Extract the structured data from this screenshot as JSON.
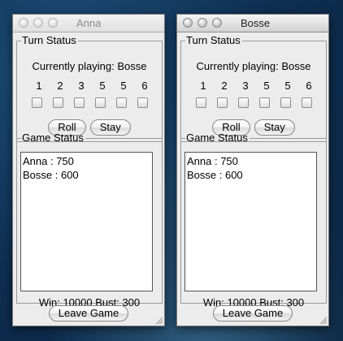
{
  "windows": [
    {
      "title": "Anna",
      "active": false,
      "turn_status": {
        "legend": "Turn Status",
        "currently_playing": "Currently playing: Bosse",
        "dice_labels": [
          "1",
          "2",
          "3",
          "5",
          "5",
          "6"
        ],
        "dice_checked": [
          false,
          false,
          false,
          false,
          false,
          false
        ],
        "roll_label": "Roll",
        "stay_label": "Stay"
      },
      "game_status": {
        "legend": "Game Status",
        "scores": [
          "Anna : 750",
          "Bosse : 600"
        ],
        "win_bust": "Win: 10000 Bust: 300"
      },
      "leave_label": "Leave Game"
    },
    {
      "title": "Bosse",
      "active": true,
      "turn_status": {
        "legend": "Turn Status",
        "currently_playing": "Currently playing: Bosse",
        "dice_labels": [
          "1",
          "2",
          "3",
          "5",
          "5",
          "6"
        ],
        "dice_checked": [
          false,
          false,
          false,
          false,
          false,
          false
        ],
        "roll_label": "Roll",
        "stay_label": "Stay"
      },
      "game_status": {
        "legend": "Game Status",
        "scores": [
          "Anna : 750",
          "Bosse : 600"
        ],
        "win_bust": "Win: 10000 Bust: 300"
      },
      "leave_label": "Leave Game"
    }
  ]
}
